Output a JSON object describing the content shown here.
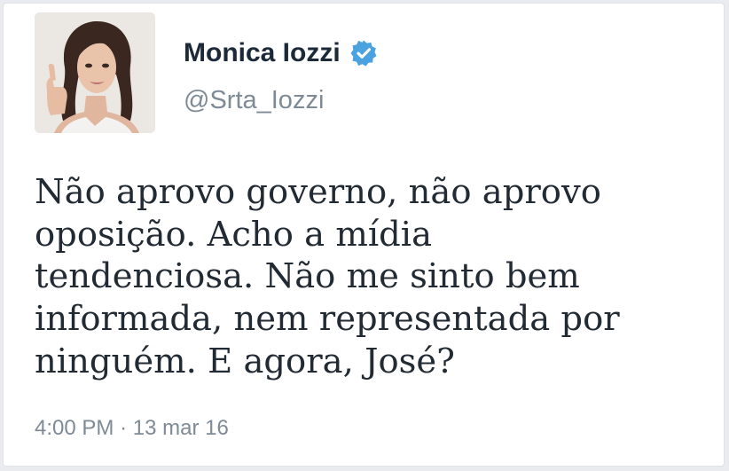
{
  "user": {
    "display_name": "Monica Iozzi",
    "handle": "@Srta_Iozzi",
    "verified": true,
    "avatar_icon": "profile-photo"
  },
  "tweet": {
    "lines": [
      "Não aprovo governo, não aprovo",
      "oposição. Acho a mídia",
      "tendenciosa. Não me sinto bem",
      "informada, nem representada por",
      "ninguém. E agora, José?"
    ],
    "time": "4:00 PM",
    "separator": "·",
    "date": "13 mar 16"
  },
  "colors": {
    "verified": "#4aa3df",
    "name": "#1c2938",
    "secondary": "#7e8a96",
    "text": "#222a33"
  }
}
